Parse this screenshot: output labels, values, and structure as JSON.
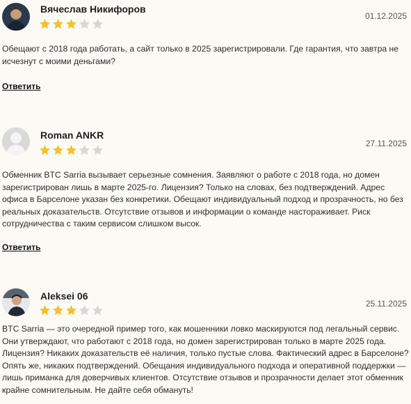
{
  "reviews": [
    {
      "name": "Вячеслав Никифоров",
      "date": "01.12.2025",
      "rating": 3,
      "avatar": "person-photo-avatar-icon",
      "text": "Обещают с 2018 года работать, а сайт только в 2025 зарегистрировали. Где гарантия, что завтра не исчезнут с моими деньгами?",
      "reply_label": "Ответить"
    },
    {
      "name": "Roman ANKR",
      "date": "27.11.2025",
      "rating": 3,
      "avatar": "default-user-avatar-icon",
      "text": "Обменник BTC Sarria вызывает серьезные сомнения. Заявляют о работе с 2018 года, но домен зарегистрирован лишь в марте 2025-го. Лицензия? Только на словах, без подтверждений. Адрес офиса в Барселоне указан без конкретики. Обещают индивидуальный подход и прозрачность, но без реальных доказательств. Отсутствие отзывов и информации о команде настораживает. Риск сотрудничества с таким сервисом слишком высок.",
      "reply_label": "Ответить"
    },
    {
      "name": "Aleksei 06",
      "date": "25.11.2025",
      "rating": 3,
      "avatar": "person-photo-avatar-icon",
      "text": "BTC Sarria — это очередной пример того, как мошенники ловко маскируются под легальный сервис. Они утверждают, что работают с 2018 года, но домен зарегистрирован только в марте 2025 года. Лицензия? Никаких доказательств её наличия, только пустые слова. Фактический адрес в Барселоне? Опять же, никаких подтверждений. Обещания индивидуального подхода и оперативной поддержки — лишь приманка для доверчивых клиентов. Отсутствие отзывов и прозрачности делает этот обменник крайне сомнительным. Не дайте себя обмануть!"
    }
  ],
  "colors": {
    "star_filled": "#f2c230",
    "star_empty": "#d6d6d6",
    "background": "#fcfaf4"
  }
}
